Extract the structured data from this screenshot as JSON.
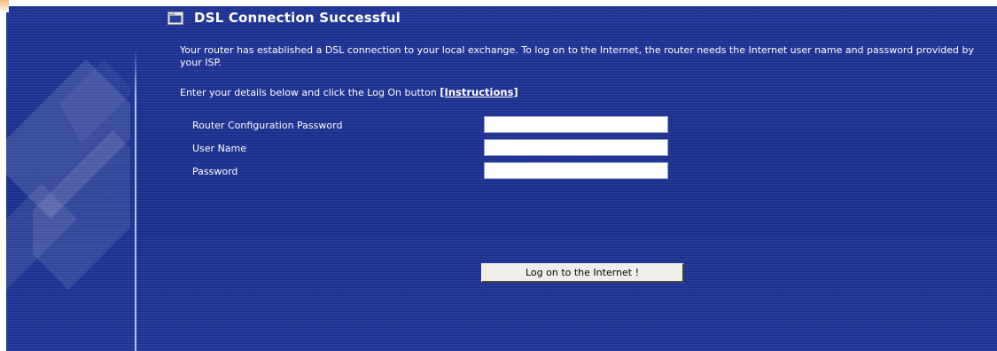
{
  "header": {
    "icon": "folder-icon",
    "title": "DSL Connection Successful"
  },
  "intro": {
    "text": "Your router has established a DSL connection to your local exchange. To log on to the Internet, the router needs the Internet user name and password provided by your ISP.",
    "enter_text": "Enter your details below and click the Log On button ",
    "instructions_link": "[Instructions]"
  },
  "form": {
    "fields": [
      {
        "label": "Router Configuration Password",
        "value": ""
      },
      {
        "label": "User Name",
        "value": ""
      },
      {
        "label": "Password",
        "value": ""
      }
    ],
    "submit_label": "Log on to the Internet !"
  },
  "colors": {
    "background": "#1a2f8e",
    "text": "#ffffff",
    "accent": "#f5b77c"
  }
}
